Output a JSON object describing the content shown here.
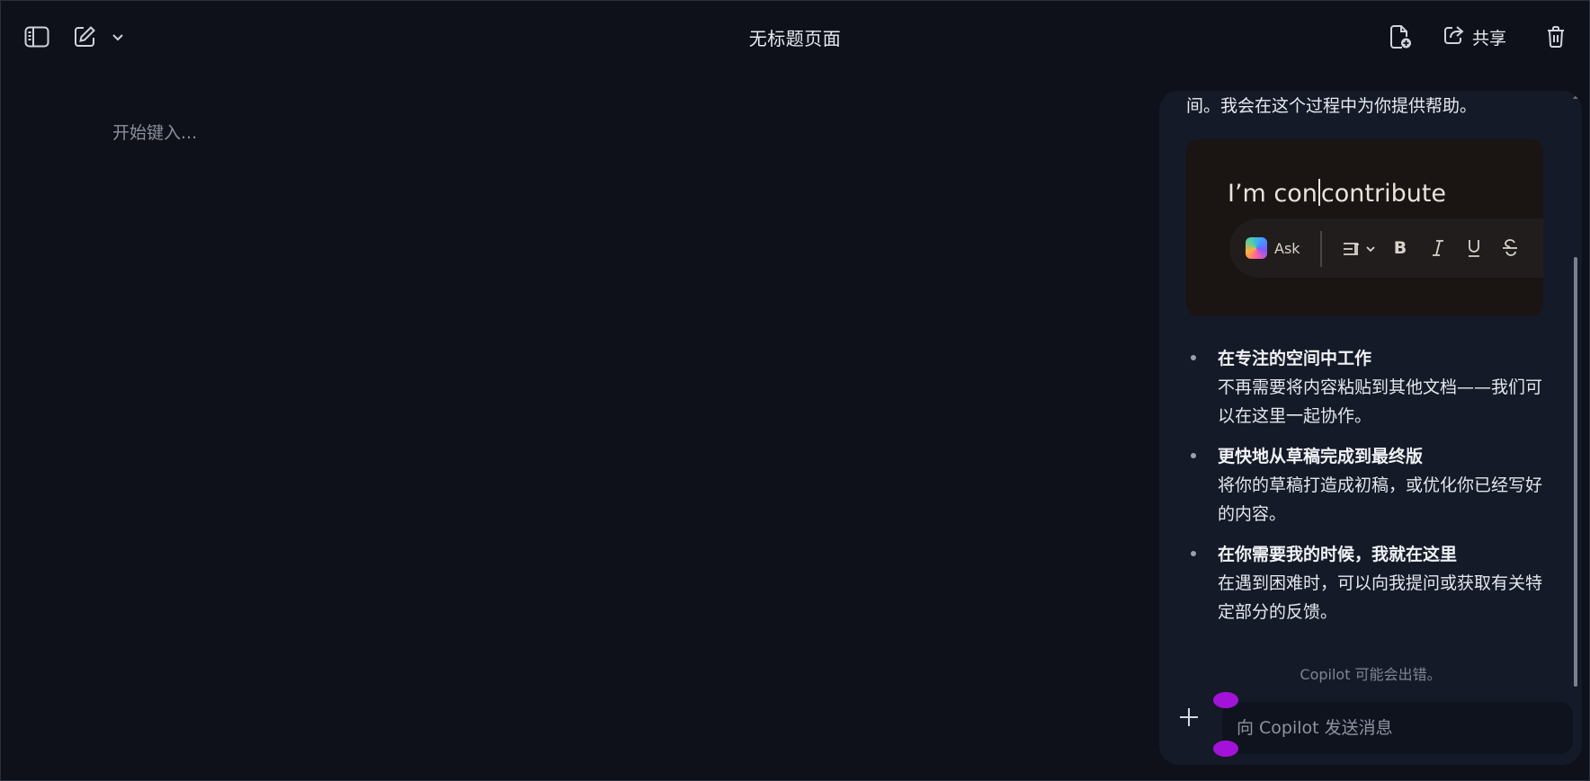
{
  "topbar": {
    "title": "无标题页面",
    "share_label": "共享",
    "icons": {
      "sidebar": "sidebar-toggle-icon",
      "new_page": "compose-icon",
      "dropdown": "chevron-down-icon",
      "add_page": "page-add-icon",
      "share": "share-icon",
      "delete": "trash-icon"
    }
  },
  "editor": {
    "placeholder": "开始键入..."
  },
  "copilot": {
    "intro_tail": "间。我会在这个过程中为你提供帮助。",
    "demo": {
      "text_before_cursor": "I’m con",
      "text_after_cursor": "contribute",
      "ask_label": "Ask",
      "tools": [
        "paragraph-format-icon",
        "bold-icon",
        "italic-icon",
        "underline-icon",
        "strikethrough-icon"
      ]
    },
    "features": [
      {
        "title": "在专注的空间中工作",
        "desc": "不再需要将内容粘贴到其他文档——我们可以在这里一起协作。"
      },
      {
        "title": "更快地从草稿完成到最终版",
        "desc": "将你的草稿打造成初稿，或优化你已经写好的内容。"
      },
      {
        "title": "在你需要我的时候，我就在这里",
        "desc": "在遇到困难时，可以向我提问或获取有关特定部分的反馈。"
      }
    ],
    "disclaimer": "Copilot 可能会出错。",
    "composer": {
      "placeholder": "向 Copilot 发送消息",
      "value": ""
    }
  },
  "colors": {
    "background": "#0e111a",
    "panel": "#141a27",
    "selection_handle": "#a312d8"
  }
}
